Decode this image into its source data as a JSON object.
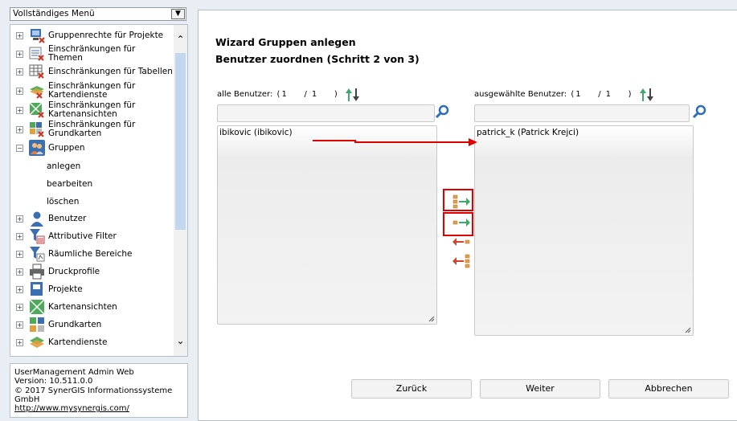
{
  "menu": {
    "select_value": "Vollständiges Menü",
    "items": [
      {
        "label": "Gruppenrechte für Projekte",
        "icon": "group-rights-icon"
      },
      {
        "label": "Einschränkungen für Themen",
        "icon": "restriction-topics-icon"
      },
      {
        "label": "Einschränkungen für Tabellen",
        "icon": "restriction-tables-icon"
      },
      {
        "label": "Einschränkungen für Kartendienste",
        "icon": "restriction-mapservices-icon"
      },
      {
        "label": "Einschränkungen für Kartenansichten",
        "icon": "restriction-mapviews-icon"
      },
      {
        "label": "Einschränkungen für Grundkarten",
        "icon": "restriction-basemaps-icon"
      },
      {
        "label": "Gruppen",
        "icon": "groups-icon"
      },
      {
        "label": "Benutzer",
        "icon": "user-icon"
      },
      {
        "label": "Attributive Filter",
        "icon": "attribute-filter-icon"
      },
      {
        "label": "Räumliche Bereiche",
        "icon": "spatial-area-icon"
      },
      {
        "label": "Druckprofile",
        "icon": "print-profile-icon"
      },
      {
        "label": "Projekte",
        "icon": "projects-icon"
      },
      {
        "label": "Kartenansichten",
        "icon": "map-views-icon"
      },
      {
        "label": "Grundkarten",
        "icon": "basemaps-icon"
      },
      {
        "label": "Kartendienste",
        "icon": "map-services-icon"
      }
    ],
    "group_sub": [
      "anlegen",
      "bearbeiten",
      "löschen"
    ]
  },
  "info": {
    "line1": "UserManagement Admin Web",
    "line2": "Version: 10.511.0.0",
    "line3": "© 2017 SynerGIS Informationssysteme GmbH",
    "link": "http://www.mysynergis.com/"
  },
  "wizard": {
    "title": "Wizard Gruppen anlegen",
    "subtitle": "Benutzer zuordnen (Schritt 2 von 3)",
    "all_users": {
      "label": "alle Benutzer:",
      "page": "1",
      "total": "1",
      "items": [
        "ibikovic (ibikovic)"
      ]
    },
    "selected_users": {
      "label": "ausgewählte Benutzer:",
      "page": "1",
      "total": "1",
      "items": [
        "patrick_k (Patrick Krejci)"
      ]
    },
    "buttons": {
      "back": "Zurück",
      "next": "Weiter",
      "cancel": "Abbrechen"
    }
  },
  "colors": {
    "accent_green": "#3fa86b",
    "accent_red": "#d0452a",
    "highlight": "#e00000",
    "item_orange": "#e0a050"
  }
}
